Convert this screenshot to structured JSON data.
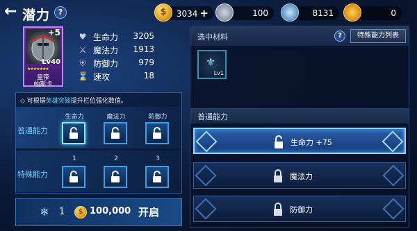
{
  "header": {
    "back_icon": "back-arrow-icon",
    "title": "潜力",
    "help": "?"
  },
  "resources": {
    "gold": "3034",
    "gold_plus": "+",
    "res2": "100",
    "res3": "8131",
    "res4": "0"
  },
  "hero": {
    "plus": "+5",
    "level": "Lv40",
    "stars": "★★★★★★★",
    "name_line1": "皇帝",
    "name_line2": "帕斯卡"
  },
  "stats": [
    {
      "label": "生命力",
      "value": "3205",
      "icon": "heart-icon"
    },
    {
      "label": "魔法力",
      "value": "1913",
      "icon": "swords-icon"
    },
    {
      "label": "防御力",
      "value": "979",
      "icon": "shield-icon"
    },
    {
      "label": "速攻",
      "value": "18",
      "icon": "hourglass-icon"
    }
  ],
  "upgrade_panel": {
    "hint_prefix": "◇ 可根据",
    "hint_accent": "英雄突破",
    "hint_suffix": "提升栏位强化数值。",
    "row1_label": "普通能力",
    "row2_label": "特殊能力",
    "row1_cols": [
      "生命力",
      "魔法力",
      "防御力"
    ],
    "row2_cols": [
      "1",
      "2",
      "3"
    ]
  },
  "cost_bar": {
    "count": "1",
    "cost": "100,000",
    "open_label": "开启"
  },
  "material_panel": {
    "title": "选中材料",
    "help": "?",
    "special_list_btn": "特殊能力列表",
    "material_level": "Lv1",
    "section_title": "普通能力"
  },
  "abilities": [
    {
      "label": "生命力 +75",
      "active": true
    },
    {
      "label": "魔法力",
      "active": false
    },
    {
      "label": "防御力",
      "active": false
    }
  ],
  "colors": {
    "accent": "#4fd0ff",
    "gold": "#e0a020",
    "panel_border": "#3a76c0"
  }
}
